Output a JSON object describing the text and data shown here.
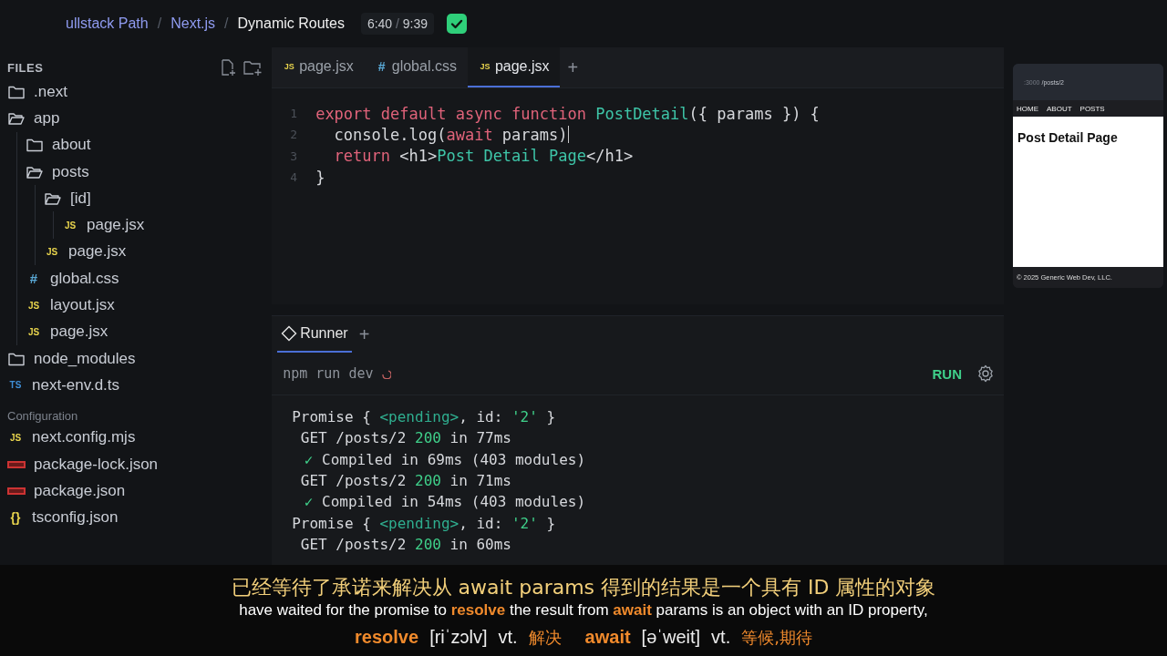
{
  "header": {
    "breadcrumbs": [
      {
        "text": "ullstack Path",
        "kind": "link"
      },
      {
        "text": "Next.js",
        "kind": "link"
      },
      {
        "text": "Dynamic Routes",
        "kind": "current"
      }
    ],
    "separator": "/",
    "time_elapsed": "6:40",
    "time_separator": "/",
    "time_total": "9:39",
    "completed": true
  },
  "sidebar": {
    "title": "FILES",
    "tree": [
      {
        "name": ".next",
        "kind": "folder",
        "expanded": false
      },
      {
        "name": "app",
        "kind": "folder",
        "expanded": true,
        "children": [
          {
            "name": "about",
            "kind": "folder",
            "expanded": false
          },
          {
            "name": "posts",
            "kind": "folder",
            "expanded": true,
            "children": [
              {
                "name": "[id]",
                "kind": "folder",
                "expanded": true,
                "children": [
                  {
                    "name": "page.jsx",
                    "kind": "js",
                    "badge": "JS"
                  }
                ]
              },
              {
                "name": "page.jsx",
                "kind": "js",
                "badge": "JS"
              }
            ]
          },
          {
            "name": "global.css",
            "kind": "css",
            "badge": "#"
          },
          {
            "name": "layout.jsx",
            "kind": "js",
            "badge": "JS"
          },
          {
            "name": "page.jsx",
            "kind": "js",
            "badge": "JS"
          }
        ]
      },
      {
        "name": "node_modules",
        "kind": "folder",
        "expanded": false
      },
      {
        "name": "next-env.d.ts",
        "kind": "ts",
        "badge": "TS"
      }
    ],
    "section": "Configuration",
    "config_files": [
      {
        "name": "next.config.mjs",
        "kind": "js",
        "badge": "JS"
      },
      {
        "name": "package-lock.json",
        "kind": "npm"
      },
      {
        "name": "package.json",
        "kind": "npm"
      },
      {
        "name": "tsconfig.json",
        "kind": "json",
        "badge": "{}"
      }
    ]
  },
  "editor": {
    "tabs": [
      {
        "label": "page.jsx",
        "kind": "js",
        "badge": "JS",
        "selected": false
      },
      {
        "label": "global.css",
        "kind": "css",
        "badge": "#",
        "selected": false
      },
      {
        "label": "page.jsx",
        "kind": "js",
        "badge": "JS",
        "selected": true
      }
    ],
    "add_tab": "+",
    "lines": [
      {
        "number": "1",
        "tokens": [
          {
            "kind": "kw",
            "text": "export default async function "
          },
          {
            "kind": "fn",
            "text": "PostDetail"
          },
          {
            "kind": "plain",
            "text": "({ params }) {"
          }
        ]
      },
      {
        "number": "2",
        "cursor": true,
        "tokens": [
          {
            "kind": "plain",
            "text": "  console.log("
          },
          {
            "kind": "kw",
            "text": "await "
          },
          {
            "kind": "plain",
            "text": "params)"
          }
        ]
      },
      {
        "number": "3",
        "tokens": [
          {
            "kind": "kw",
            "text": "  return "
          },
          {
            "kind": "plain",
            "text": "<h1>"
          },
          {
            "kind": "fn",
            "text": "Post Detail Page"
          },
          {
            "kind": "plain",
            "text": "</h1>"
          }
        ]
      },
      {
        "number": "4",
        "tokens": [
          {
            "kind": "plain",
            "text": "}"
          }
        ]
      }
    ]
  },
  "runner": {
    "tab": "Runner",
    "add_tab": "+",
    "command": "npm run dev",
    "run_button": "RUN",
    "output": [
      [
        {
          "kind": "plain",
          "text": "Promise { "
        },
        {
          "kind": "teal",
          "text": "<pending>"
        },
        {
          "kind": "plain",
          "text": ", id: "
        },
        {
          "kind": "str",
          "text": "'2'"
        },
        {
          "kind": "plain",
          "text": " }"
        }
      ],
      [
        {
          "kind": "plain",
          "text": " GET /posts/2 "
        },
        {
          "kind": "str",
          "text": "200"
        },
        {
          "kind": "plain",
          "text": " in 77ms"
        }
      ],
      [
        {
          "kind": "check",
          "text": " ✓"
        },
        {
          "kind": "plain",
          "text": " Compiled in 69ms (403 modules)"
        }
      ],
      [
        {
          "kind": "plain",
          "text": " GET /posts/2 "
        },
        {
          "kind": "str",
          "text": "200"
        },
        {
          "kind": "plain",
          "text": " in 71ms"
        }
      ],
      [
        {
          "kind": "check",
          "text": " ✓"
        },
        {
          "kind": "plain",
          "text": " Compiled in 54ms (403 modules)"
        }
      ],
      [
        {
          "kind": "plain",
          "text": "Promise { "
        },
        {
          "kind": "teal",
          "text": "<pending>"
        },
        {
          "kind": "plain",
          "text": ", id: "
        },
        {
          "kind": "str",
          "text": "'2'"
        },
        {
          "kind": "plain",
          "text": " }"
        }
      ],
      [
        {
          "kind": "plain",
          "text": " GET /posts/2 "
        },
        {
          "kind": "str",
          "text": "200"
        },
        {
          "kind": "plain",
          "text": " in 60ms"
        }
      ]
    ]
  },
  "preview": {
    "url_host": ":3000",
    "url_path": "/posts/2",
    "nav": [
      "HOME",
      "ABOUT",
      "POSTS"
    ],
    "heading": "Post Detail Page",
    "footer": "© 2025 Generic Web Dev, LLC."
  },
  "subtitles": {
    "zh": "已经等待了承诺来解决从 await params 得到的结果是一个具有 ID 属性的对象",
    "en": [
      {
        "text": "have waited for the promise to ",
        "hl": false
      },
      {
        "text": "resolve",
        "hl": true
      },
      {
        "text": " the result from ",
        "hl": false
      },
      {
        "text": "await",
        "hl": true
      },
      {
        "text": " params is an object with an ID property,",
        "hl": false
      }
    ],
    "vocab": [
      {
        "word": "resolve",
        "phonetic": "[riˈzɔlv]",
        "pos": "vt.",
        "meaning": "解决"
      },
      {
        "word": "await",
        "phonetic": "[əˈweit]",
        "pos": "vt.",
        "meaning": "等候,期待"
      }
    ]
  }
}
